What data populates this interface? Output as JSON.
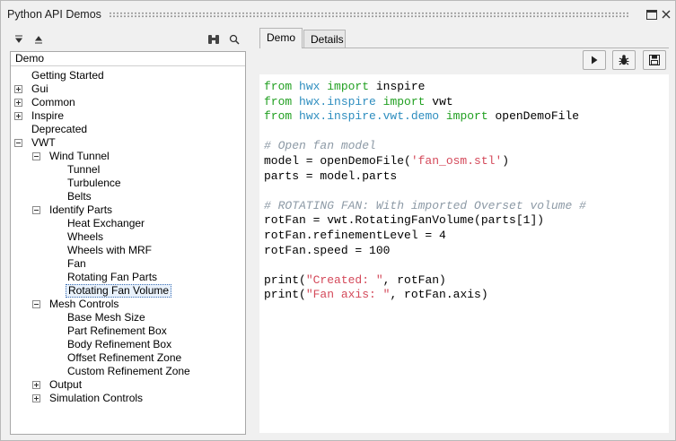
{
  "window": {
    "title": "Python API Demos"
  },
  "tree": {
    "header": "Demo",
    "rows": [
      {
        "label": "Getting Started",
        "depth": 0,
        "toggle": "none"
      },
      {
        "label": "Gui",
        "depth": 0,
        "toggle": "plus"
      },
      {
        "label": "Common",
        "depth": 0,
        "toggle": "plus"
      },
      {
        "label": "Inspire",
        "depth": 0,
        "toggle": "plus"
      },
      {
        "label": "Deprecated",
        "depth": 0,
        "toggle": "none"
      },
      {
        "label": "VWT",
        "depth": 0,
        "toggle": "minus"
      },
      {
        "label": "Wind Tunnel",
        "depth": 1,
        "toggle": "minus"
      },
      {
        "label": "Tunnel",
        "depth": 2,
        "toggle": "none"
      },
      {
        "label": "Turbulence",
        "depth": 2,
        "toggle": "none"
      },
      {
        "label": "Belts",
        "depth": 2,
        "toggle": "none"
      },
      {
        "label": "Identify Parts",
        "depth": 1,
        "toggle": "minus"
      },
      {
        "label": "Heat Exchanger",
        "depth": 2,
        "toggle": "none"
      },
      {
        "label": "Wheels",
        "depth": 2,
        "toggle": "none"
      },
      {
        "label": "Wheels with MRF",
        "depth": 2,
        "toggle": "none"
      },
      {
        "label": "Fan",
        "depth": 2,
        "toggle": "none"
      },
      {
        "label": "Rotating Fan Parts",
        "depth": 2,
        "toggle": "none"
      },
      {
        "label": "Rotating Fan Volume",
        "depth": 2,
        "toggle": "none",
        "selected": true
      },
      {
        "label": "Mesh Controls",
        "depth": 1,
        "toggle": "minus"
      },
      {
        "label": "Base Mesh Size",
        "depth": 2,
        "toggle": "none"
      },
      {
        "label": "Part Refinement Box",
        "depth": 2,
        "toggle": "none"
      },
      {
        "label": "Body Refinement Box",
        "depth": 2,
        "toggle": "none"
      },
      {
        "label": "Offset Refinement Zone",
        "depth": 2,
        "toggle": "none"
      },
      {
        "label": "Custom Refinement Zone",
        "depth": 2,
        "toggle": "none"
      },
      {
        "label": "Output",
        "depth": 1,
        "toggle": "plus"
      },
      {
        "label": "Simulation Controls",
        "depth": 1,
        "toggle": "plus"
      }
    ]
  },
  "tabs": [
    {
      "label": "Demo",
      "active": true
    },
    {
      "label": "Details",
      "active": false
    }
  ],
  "toolbar": {
    "icons": [
      "expand-all-icon",
      "collapse-all-icon",
      "binoculars-icon",
      "search-icon",
      "run-icon",
      "debug-icon",
      "save-icon"
    ]
  },
  "code": {
    "lines": [
      [
        [
          "kw",
          "from "
        ],
        [
          "mod",
          "hwx"
        ],
        [
          "kw",
          " import "
        ],
        [
          "",
          "inspire"
        ]
      ],
      [
        [
          "kw",
          "from "
        ],
        [
          "mod",
          "hwx.inspire"
        ],
        [
          "kw",
          " import "
        ],
        [
          "",
          "vwt"
        ]
      ],
      [
        [
          "kw",
          "from "
        ],
        [
          "mod",
          "hwx.inspire.vwt.demo"
        ],
        [
          "kw",
          " import "
        ],
        [
          "",
          "openDemoFile"
        ]
      ],
      [],
      [
        [
          "cm",
          "# Open fan model"
        ]
      ],
      [
        [
          "",
          "model = openDemoFile("
        ],
        [
          "str",
          "'fan_osm.stl'"
        ],
        [
          "",
          ")"
        ]
      ],
      [
        [
          "",
          "parts = model.parts"
        ]
      ],
      [],
      [
        [
          "cm",
          "# ROTATING FAN: With imported Overset volume #"
        ]
      ],
      [
        [
          "",
          "rotFan = vwt.RotatingFanVolume(parts[1])"
        ]
      ],
      [
        [
          "",
          "rotFan.refinementLevel = 4"
        ]
      ],
      [
        [
          "",
          "rotFan.speed = 100"
        ]
      ],
      [],
      [
        [
          "",
          "print("
        ],
        [
          "str",
          "\"Created: \""
        ],
        [
          "",
          ", rotFan)"
        ]
      ],
      [
        [
          "",
          "print("
        ],
        [
          "str",
          "\"Fan axis: \""
        ],
        [
          "",
          ", rotFan.axis)"
        ]
      ]
    ]
  },
  "colors": {
    "keyword": "#22a022",
    "module": "#2d8dbf",
    "comment": "#8d9aa6",
    "string": "#d4495a"
  }
}
